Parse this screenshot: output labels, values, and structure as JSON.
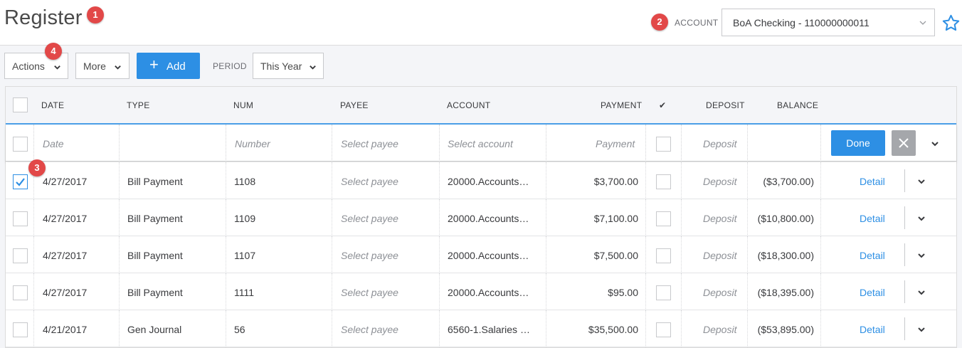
{
  "header": {
    "title": "Register",
    "account_label": "ACCOUNT",
    "account_value": "BoA Checking - 110000000011",
    "favorite_icon": "star-icon"
  },
  "callouts": [
    "1",
    "2",
    "3",
    "4"
  ],
  "toolbar": {
    "actions_label": "Actions",
    "more_label": "More",
    "add_label": "Add",
    "period_label": "PERIOD",
    "period_value": "This Year"
  },
  "columns": {
    "date": "DATE",
    "type": "TYPE",
    "num": "NUM",
    "payee": "PAYEE",
    "account": "ACCOUNT",
    "payment": "PAYMENT",
    "cleared": "✔",
    "deposit": "DEPOSIT",
    "balance": "BALANCE"
  },
  "edit_row": {
    "date_placeholder": "Date",
    "number_placeholder": "Number",
    "payee_placeholder": "Select payee",
    "account_placeholder": "Select account",
    "payment_placeholder": "Payment",
    "deposit_placeholder": "Deposit",
    "done_label": "Done"
  },
  "rows": [
    {
      "date": "4/27/2017",
      "type": "Bill Payment",
      "num": "1108",
      "payee": "Select payee",
      "account": "20000.Accounts…",
      "payment": "$3,700.00",
      "deposit": "Deposit",
      "balance": "($3,700.00)",
      "detail": "Detail",
      "selected": true
    },
    {
      "date": "4/27/2017",
      "type": "Bill Payment",
      "num": "1109",
      "payee": "Select payee",
      "account": "20000.Accounts…",
      "payment": "$7,100.00",
      "deposit": "Deposit",
      "balance": "($10,800.00)",
      "detail": "Detail",
      "selected": false
    },
    {
      "date": "4/27/2017",
      "type": "Bill Payment",
      "num": "1107",
      "payee": "Select payee",
      "account": "20000.Accounts…",
      "payment": "$7,500.00",
      "deposit": "Deposit",
      "balance": "($18,300.00)",
      "detail": "Detail",
      "selected": false
    },
    {
      "date": "4/27/2017",
      "type": "Bill Payment",
      "num": "1111",
      "payee": "Select payee",
      "account": "20000.Accounts…",
      "payment": "$95.00",
      "deposit": "Deposit",
      "balance": "($18,395.00)",
      "detail": "Detail",
      "selected": false
    },
    {
      "date": "4/21/2017",
      "type": "Gen Journal",
      "num": "56",
      "payee": "Select payee",
      "account": "6560-1.Salaries …",
      "payment": "$35,500.00",
      "deposit": "Deposit",
      "balance": "($53,895.00)",
      "detail": "Detail",
      "selected": false
    }
  ],
  "colors": {
    "accent": "#2d8fe4",
    "callout": "#e24848",
    "background": "#f4f5f8"
  }
}
